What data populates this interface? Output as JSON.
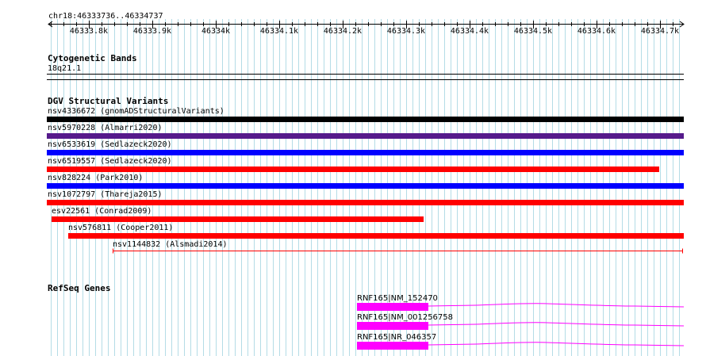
{
  "ruler": {
    "location": "chr18:46333736..46334737",
    "ticks": [
      {
        "label": "46333.8k",
        "bp": 46333800
      },
      {
        "label": "46333.9k",
        "bp": 46333900
      },
      {
        "label": "46334k",
        "bp": 46334000
      },
      {
        "label": "46334.1k",
        "bp": 46334100
      },
      {
        "label": "46334.2k",
        "bp": 46334200
      },
      {
        "label": "46334.3k",
        "bp": 46334300
      },
      {
        "label": "46334.4k",
        "bp": 46334400
      },
      {
        "label": "46334.5k",
        "bp": 46334500
      },
      {
        "label": "46334.6k",
        "bp": 46334600
      },
      {
        "label": "46334.7k",
        "bp": 46334700
      }
    ]
  },
  "cytoband_track": {
    "title": "Cytogenetic Bands",
    "band": "18q21.1"
  },
  "dgv_track": {
    "title": "DGV Structural Variants",
    "variants": [
      {
        "label": "nsv4336672 (gnomADStructuralVariants)",
        "color": "#000000",
        "style": "solid"
      },
      {
        "label": "nsv5970228 (Almarri2020)",
        "color": "#551a8b",
        "style": "solid"
      },
      {
        "label": "nsv6533619 (Sedlazeck2020)",
        "color": "#0000ff",
        "style": "solid"
      },
      {
        "label": "nsv6519557 (Sedlazeck2020)",
        "color": "#ff0000",
        "style": "solid"
      },
      {
        "label": "nsv828224 (Park2010)",
        "color": "#0000ff",
        "style": "solid"
      },
      {
        "label": "nsv1072797 (Thareja2015)",
        "color": "#ff0000",
        "style": "solid"
      },
      {
        "label": "esv22561 (Conrad2009)",
        "color": "#ff0000",
        "style": "solid"
      },
      {
        "label": "nsv576811 (Cooper2011)",
        "color": "#ff0000",
        "style": "solid"
      },
      {
        "label": "nsv1144832 (Alsmadi2014)",
        "color": "#ff0000",
        "style": "thin"
      }
    ]
  },
  "refseq_track": {
    "title": "RefSeq Genes",
    "genes": [
      {
        "label": "RNF165|NM_152470"
      },
      {
        "label": "RNF165|NM_001256758"
      },
      {
        "label": "RNF165|NR_046357"
      }
    ],
    "gene_color": "#ff00ff"
  },
  "colors": {
    "grid_line": "#b4dce6",
    "background": "#ffffff"
  }
}
